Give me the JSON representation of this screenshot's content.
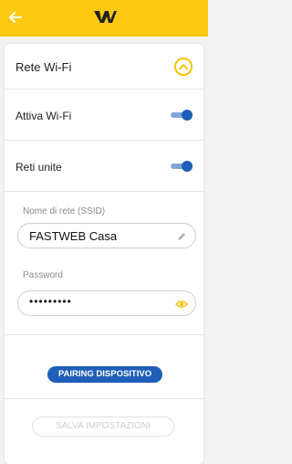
{
  "header": {
    "back_icon": "arrow-left-icon",
    "logo_icon": "w-brand-logo",
    "background": "#fcc910"
  },
  "card": {
    "title": "Rete Wi-Fi",
    "collapse_icon": "chevron-up-circle-icon"
  },
  "toggles": [
    {
      "label": "Attiva Wi-Fi",
      "on": true
    },
    {
      "label": "Reti unite",
      "on": true
    }
  ],
  "ssid": {
    "label": "Nome di rete (SSID)",
    "value": "FASTWEB Casa",
    "icon": "pencil-icon"
  },
  "password": {
    "label": "Password",
    "value": "•••••••••",
    "icon": "eye-icon"
  },
  "buttons": {
    "pairing": "PAIRING DISPOSITIVO",
    "save": "SALVA IMPOSTAZIONI"
  },
  "colors": {
    "accent_yellow": "#fcc910",
    "primary_blue": "#1f5fb8",
    "disabled_text": "#cfcfcf"
  }
}
